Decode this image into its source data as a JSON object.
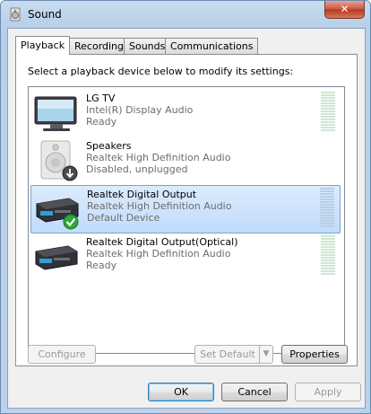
{
  "window": {
    "title": "Sound",
    "close_label": "✕"
  },
  "tabs": [
    {
      "label": "Playback",
      "active": true
    },
    {
      "label": "Recording",
      "active": false
    },
    {
      "label": "Sounds",
      "active": false
    },
    {
      "label": "Communications",
      "active": false
    }
  ],
  "instruction": "Select a playback device below to modify its settings:",
  "devices": [
    {
      "name": "LG TV",
      "driver": "Intel(R) Display Audio",
      "status": "Ready",
      "icon": "monitor-icon",
      "selected": false
    },
    {
      "name": "Speakers",
      "driver": "Realtek High Definition Audio",
      "status": "Disabled, unplugged",
      "icon": "speaker-icon",
      "selected": false
    },
    {
      "name": "Realtek Digital Output",
      "driver": "Realtek High Definition Audio",
      "status": "Default Device",
      "icon": "digital-output-icon",
      "selected": true
    },
    {
      "name": "Realtek Digital Output(Optical)",
      "driver": "Realtek High Definition Audio",
      "status": "Ready",
      "icon": "digital-output-icon",
      "selected": false
    }
  ],
  "buttons": {
    "configure": "Configure",
    "set_default": "Set Default",
    "properties": "Properties",
    "ok": "OK",
    "cancel": "Cancel",
    "apply": "Apply"
  },
  "colors": {
    "selection": "#c1dbfc",
    "default_check": "#2fa73a"
  }
}
